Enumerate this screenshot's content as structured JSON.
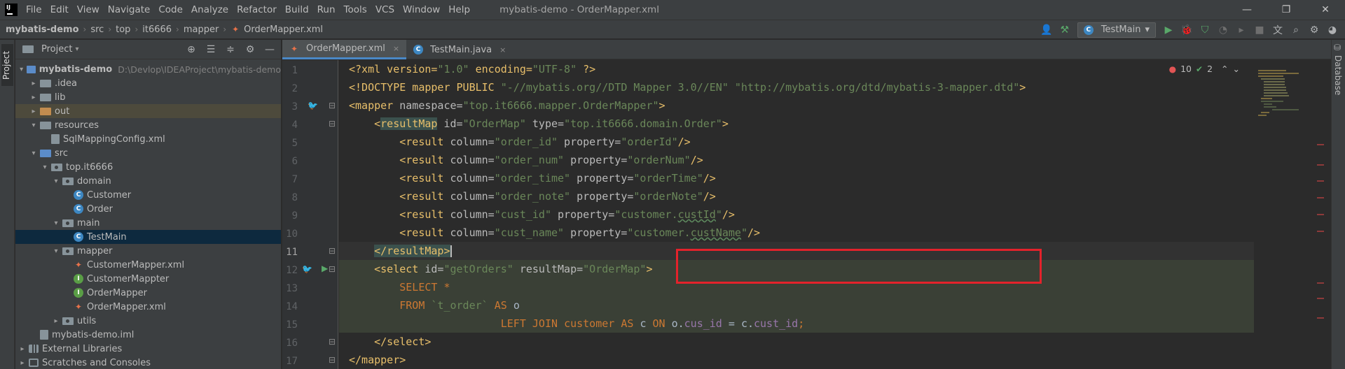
{
  "menubar": {
    "logo": "IJ",
    "items": [
      "File",
      "Edit",
      "View",
      "Navigate",
      "Code",
      "Analyze",
      "Refactor",
      "Build",
      "Run",
      "Tools",
      "VCS",
      "Window",
      "Help"
    ],
    "window_title": "mybatis-demo - OrderMapper.xml"
  },
  "breadcrumb": [
    "mybatis-demo",
    "src",
    "top",
    "it6666",
    "mapper",
    "OrderMapper.xml"
  ],
  "run_config": "TestMain",
  "project": {
    "title": "Project",
    "tree": [
      {
        "label": "mybatis-demo",
        "path": "D:\\Devlop\\IDEAProject\\mybatis-demo"
      },
      {
        "label": ".idea"
      },
      {
        "label": "lib"
      },
      {
        "label": "out"
      },
      {
        "label": "resources"
      },
      {
        "label": "SqlMappingConfig.xml"
      },
      {
        "label": "src"
      },
      {
        "label": "top.it6666"
      },
      {
        "label": "domain"
      },
      {
        "label": "Customer",
        "icon_letter": "C"
      },
      {
        "label": "Order",
        "icon_letter": "C"
      },
      {
        "label": "main"
      },
      {
        "label": "TestMain",
        "icon_letter": "C"
      },
      {
        "label": "mapper"
      },
      {
        "label": "CustomerMapper.xml"
      },
      {
        "label": "CustomerMappter",
        "icon_letter": "I"
      },
      {
        "label": "OrderMapper",
        "icon_letter": "I"
      },
      {
        "label": "OrderMapper.xml"
      },
      {
        "label": "utils"
      },
      {
        "label": "mybatis-demo.iml"
      },
      {
        "label": "External Libraries"
      },
      {
        "label": "Scratches and Consoles"
      }
    ]
  },
  "side_tabs": {
    "left": "Project",
    "right": "Database"
  },
  "editor": {
    "tabs": [
      {
        "label": "OrderMapper.xml",
        "close": "×"
      },
      {
        "label": "TestMain.java",
        "close": "×"
      }
    ],
    "inspections": {
      "errors": "10",
      "warnings": "2"
    },
    "line_numbers": [
      "1",
      "2",
      "3",
      "4",
      "5",
      "6",
      "7",
      "8",
      "9",
      "10",
      "11",
      "12",
      "13",
      "14",
      "15",
      "16",
      "17"
    ],
    "code": {
      "l1": {
        "a": "<?xml version=",
        "b": "\"1.0\"",
        "c": " encoding=",
        "d": "\"UTF-8\"",
        "e": " ?>"
      },
      "l2": {
        "a": "<!DOCTYPE mapper PUBLIC ",
        "b": "\"-//mybatis.org//DTD Mapper 3.0//EN\"",
        "c": " ",
        "d": "\"http://mybatis.org/dtd/mybatis-3-mapper.dtd\"",
        "e": ">"
      },
      "l3": {
        "tag": "<mapper",
        "attr": " namespace=",
        "val": "\"top.it6666.mapper.OrderMapper\"",
        "end": ">"
      },
      "l4": {
        "open": "<",
        "tag": "resultMap",
        "attr1": " id=",
        "val1": "\"OrderMap\"",
        "attr2": " type=",
        "val2": "\"top.it6666.domain.Order\"",
        "end": ">"
      },
      "l5": {
        "tag": "<result",
        "attr1": " column=",
        "val1": "\"order_id\"",
        "attr2": " property=",
        "val2": "\"orderId\"",
        "end": "/>"
      },
      "l6": {
        "tag": "<result",
        "attr1": " column=",
        "val1": "\"order_num\"",
        "attr2": " property=",
        "val2": "\"orderNum\"",
        "end": "/>"
      },
      "l7": {
        "tag": "<result",
        "attr1": " column=",
        "val1": "\"order_time\"",
        "attr2": " property=",
        "val2": "\"orderTime\"",
        "end": "/>"
      },
      "l8": {
        "tag": "<result",
        "attr1": " column=",
        "val1": "\"order_note\"",
        "attr2": " property=",
        "val2": "\"orderNote\"",
        "end": "/>"
      },
      "l9": {
        "tag": "<result",
        "attr1": " column=",
        "val1": "\"cust_id\"",
        "attr2": " property=",
        "val2a": "\"customer.",
        "val2b": "custId",
        "val2c": "\"",
        "end": "/>"
      },
      "l10": {
        "tag": "<result",
        "attr1": " column=",
        "val1": "\"cust_name\"",
        "attr2": " property=",
        "val2a": "\"customer.",
        "val2b": "custName",
        "val2c": "\"",
        "end": "/>"
      },
      "l11": {
        "tag": "</resultMap>"
      },
      "l12": {
        "tag": "<select",
        "attr1": " id=",
        "val1": "\"getOrders\"",
        "attr2": " resultMap=",
        "val2": "\"OrderMap\"",
        "end": ">"
      },
      "l13": {
        "kw": "SELECT *"
      },
      "l14": {
        "kw1": "FROM ",
        "tbl": "`t_order`",
        "kw2": " AS ",
        "id": "o"
      },
      "l15": {
        "kw1": "LEFT JOIN ",
        "tbl": "customer",
        "kw2": " AS ",
        "id1": "c ",
        "kw3": "ON ",
        "id2": "o.",
        "col1": "cus_id",
        "op": " = ",
        "id3": "c.",
        "col2": "cust_id",
        "end": ";"
      },
      "l16": {
        "tag": "</select>"
      },
      "l17": {
        "tag": "</mapper>"
      }
    }
  }
}
